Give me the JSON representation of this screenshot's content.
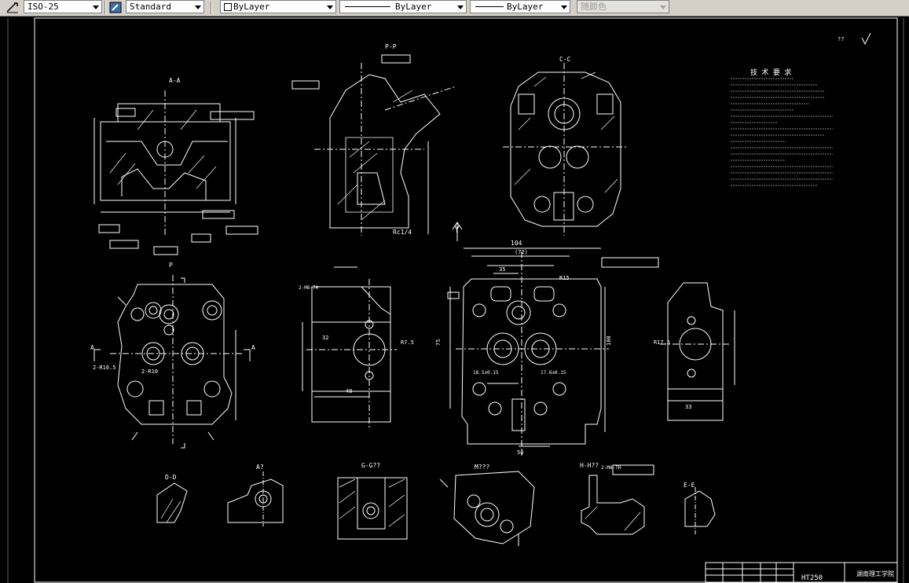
{
  "toolbar": {
    "dimstyle": "ISO-25",
    "textstyle": "Standard",
    "layer": "ByLayer",
    "linetype": "ByLayer",
    "lineweight": "ByLayer",
    "plotstyle": "随颜色"
  },
  "views": {
    "aa": "A-A",
    "pp": "P-P",
    "cc": "C-C",
    "y": "Y",
    "p": "P",
    "a_left": "A",
    "a_right": "A",
    "dd": "D-D",
    "at": "A?",
    "gg": "G-G??",
    "mm": "M???",
    "hh": "H-H??",
    "ee": "E-E"
  },
  "dims": {
    "d1046": "104",
    "d72": "(72)",
    "d35": "35",
    "r15": "R15",
    "d100": "100",
    "d75": "75",
    "d50": "50",
    "d33": "33",
    "r175": "R17.5",
    "r75": "R7.5",
    "d2r165": "2-R16.5",
    "d2r10": "2-R10",
    "rc14": "Rc1/4",
    "d2m6": "2-M6-7H",
    "d2m8": "2-M8-7H",
    "d185": "18.5±0.15",
    "d176": "17.6±0.15",
    "d32": "32",
    "d40": "40"
  },
  "frame": {
    "tech_title": "技 术 要 求",
    "material": "HT250",
    "school": "湖南理工学院",
    "roughness": "??"
  }
}
